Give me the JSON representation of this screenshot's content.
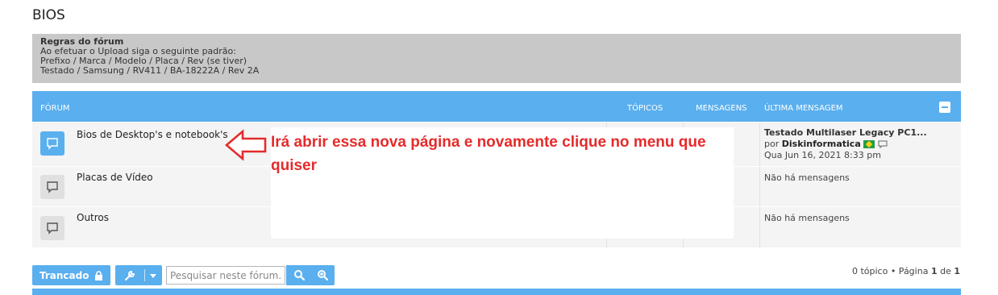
{
  "page": {
    "title": "BIOS"
  },
  "rules": {
    "title": "Regras do fórum",
    "lines": [
      "Ao efetuar o Upload siga o seguinte padrão:",
      "Prefixo / Marca / Modelo / Placa / Rev (se tiver)",
      "Testado / Samsung / RV411 / BA-18222A / Rev 2A"
    ]
  },
  "forum_table": {
    "headers": {
      "forum": "FÓRUM",
      "topics": "TÓPICOS",
      "posts": "MENSAGENS",
      "last_post": "ÚLTIMA MENSAGEM"
    },
    "rows": [
      {
        "name": "Bios de Desktop's e notebook's",
        "icon": "speech-bubble-icon",
        "unread": true,
        "last_post": {
          "title": "Testado Multilaser Legacy PC1...",
          "by": "por",
          "author": "Diskinformatica",
          "date": "Qua Jun 16, 2021 8:33 pm"
        }
      },
      {
        "name": "Placas de Vídeo",
        "icon": "speech-bubble-icon",
        "unread": false,
        "last_post": {
          "empty": "Não há mensagens"
        }
      },
      {
        "name": "Outros",
        "icon": "speech-bubble-icon",
        "unread": false,
        "last_post": {
          "empty": "Não há mensagens"
        }
      }
    ]
  },
  "annotation": {
    "text": "Irá abrir essa nova página e novamente clique no menu que quiser",
    "color": "#e52b2b"
  },
  "toolbar": {
    "locked_label": "Trancado",
    "search_placeholder": "Pesquisar neste fórum…"
  },
  "pagination": {
    "topics_text": "0 tópico • Página",
    "current": "1",
    "of": "de",
    "total": "1"
  },
  "colors": {
    "accent": "#5aafee",
    "rules_bg": "#c8c8c8",
    "row_bg": "#f4f4f4"
  }
}
